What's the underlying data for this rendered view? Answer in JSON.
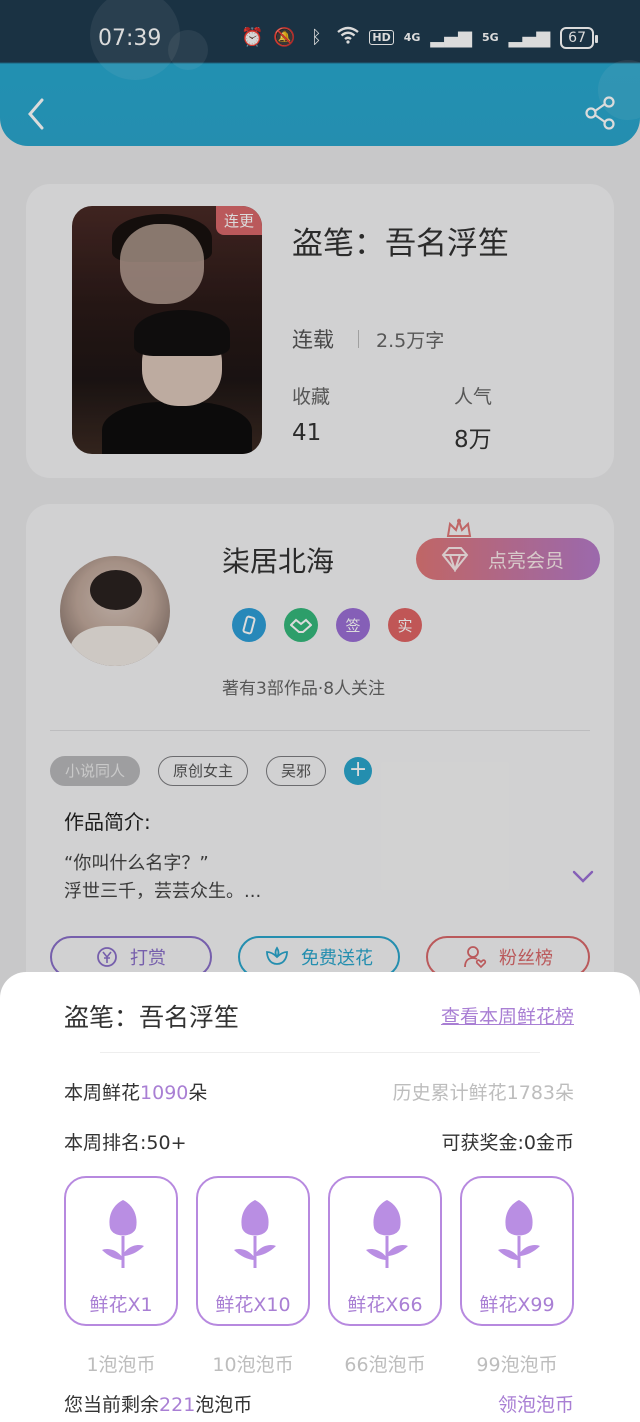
{
  "status_bar": {
    "time": "07:39",
    "hd_label": "HD",
    "net1": "4G",
    "net2": "5G",
    "battery": "67"
  },
  "nav": {
    "back_icon": "chevron-left-icon",
    "share_icon": "share-icon"
  },
  "book": {
    "title": "盗笔：吾名浮笙",
    "badge": "连更",
    "status": "连载",
    "word_count": "2.5万字",
    "favorites_label": "收藏",
    "favorites_value": "41",
    "popularity_label": "人气",
    "popularity_value": "8万"
  },
  "author": {
    "name": "柒居北海",
    "vip_button": "点亮会员",
    "badges": [
      "",
      "",
      "签",
      "实"
    ],
    "meta": "著有3部作品·8人关注",
    "tags": [
      "小说同人",
      "原创女主",
      "吴邪"
    ],
    "add_tag": "+",
    "intro_title": "作品简介:",
    "intro_line1": "“你叫什么名字？”",
    "intro_line2": "浮世三千，芸芸众生。..."
  },
  "actions": {
    "reward": "打赏",
    "free_flower": "免费送花",
    "fans": "粉丝榜"
  },
  "sheet": {
    "title": "盗笔：吾名浮笙",
    "ranking_link": "查看本周鲜花榜",
    "weekly_prefix": "本周鲜花",
    "weekly_count": "1090",
    "weekly_suffix": "朵",
    "history": "历史累计鲜花1783朵",
    "rank": "本周排名:50+",
    "bonus": "可获奖金:0金币",
    "options": [
      {
        "label": "鲜花X1",
        "price": "1泡泡币"
      },
      {
        "label": "鲜花X10",
        "price": "10泡泡币"
      },
      {
        "label": "鲜花X66",
        "price": "66泡泡币"
      },
      {
        "label": "鲜花X99",
        "price": "99泡泡币"
      }
    ],
    "balance_prefix": "您当前剩余",
    "balance_value": "221",
    "balance_suffix": "泡泡币",
    "claim_link": "领泡泡币"
  },
  "colors": {
    "accent": "#a97fd4",
    "header_blue": "#2aa6cc",
    "reward_purple": "#8a6fc9",
    "flower_blue": "#2aa6cc",
    "fans_red": "#d9686a"
  }
}
